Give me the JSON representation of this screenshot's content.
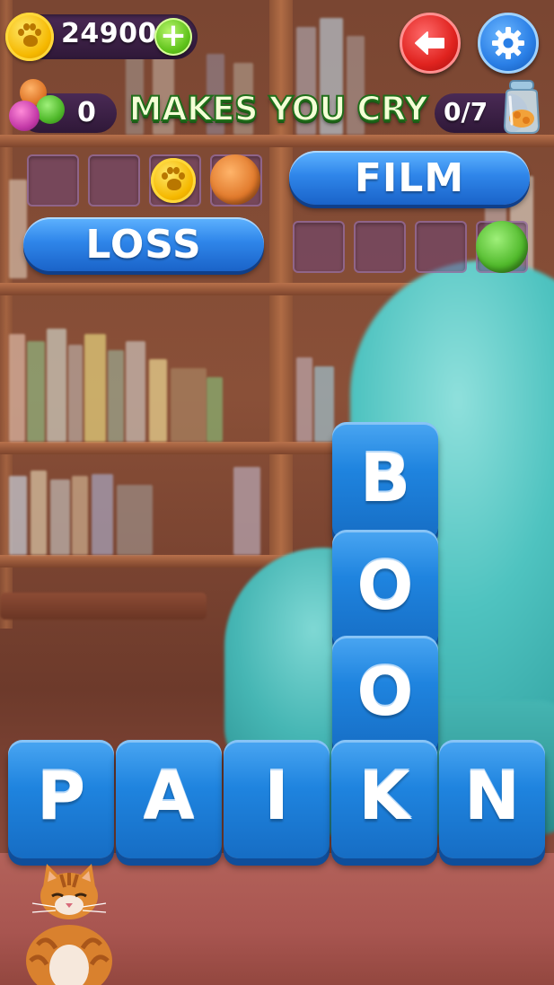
{
  "hud": {
    "coins": "24900",
    "yarn_count": "0",
    "clue": "MAKES YOU CRY",
    "progress": "0/7"
  },
  "answers": [
    {
      "word": "",
      "slots": 4,
      "revealed": [
        "paw-coin",
        "yarn-orange"
      ],
      "state": "hidden"
    },
    {
      "word": "FILM",
      "state": "solved"
    },
    {
      "word": "LOSS",
      "state": "solved"
    },
    {
      "word": "",
      "slots": 4,
      "revealed": [
        "yarn-green"
      ],
      "state": "hidden"
    }
  ],
  "tiles": {
    "vertical": [
      "B",
      "O",
      "O"
    ],
    "bottom_row": [
      "P",
      "A",
      "I",
      "K",
      "N"
    ]
  },
  "colors": {
    "tile_blue": "#1f84df",
    "clue_text": "#f4ffd6",
    "clue_stroke": "#1f6e1a",
    "back_button": "#e0231f",
    "settings_button": "#2a7fe6",
    "plus_button": "#5ec21a"
  },
  "icons": [
    "paw-coin-icon",
    "plus-icon",
    "back-arrow-icon",
    "gear-icon",
    "yarn-icon",
    "jar-icon",
    "cat-icon"
  ]
}
